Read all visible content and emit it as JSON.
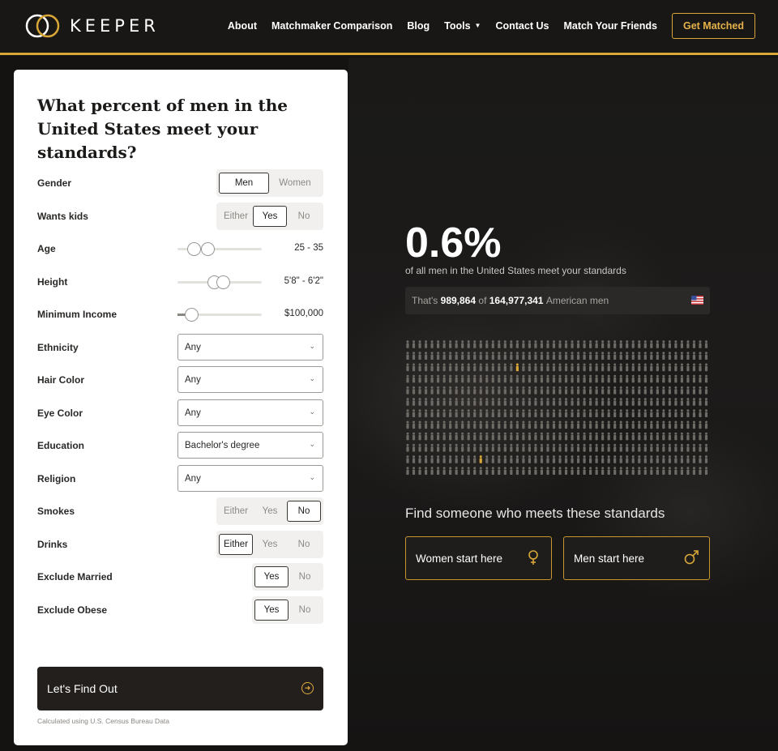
{
  "header": {
    "logo_text": "KEEPER",
    "nav": [
      {
        "label": "About"
      },
      {
        "label": "Matchmaker Comparison"
      },
      {
        "label": "Blog"
      },
      {
        "label": "Tools",
        "has_dropdown": true
      },
      {
        "label": "Contact Us"
      },
      {
        "label": "Match Your Friends"
      }
    ],
    "cta": "Get Matched",
    "accent_color": "#d9a737"
  },
  "form": {
    "title": "What percent of men in the United States meet your standards?",
    "gender": {
      "label": "Gender",
      "options": [
        "Men",
        "Women"
      ],
      "selected": "Men"
    },
    "wants_kids": {
      "label": "Wants kids",
      "options": [
        "Either",
        "Yes",
        "No"
      ],
      "selected": "Yes"
    },
    "age": {
      "label": "Age",
      "value": "25 - 35"
    },
    "height": {
      "label": "Height",
      "value": "5'8\" - 6'2\""
    },
    "income": {
      "label": "Minimum Income",
      "value": "$100,000"
    },
    "ethnicity": {
      "label": "Ethnicity",
      "value": "Any"
    },
    "hair_color": {
      "label": "Hair Color",
      "value": "Any"
    },
    "eye_color": {
      "label": "Eye Color",
      "value": "Any"
    },
    "education": {
      "label": "Education",
      "value": "Bachelor's degree"
    },
    "religion": {
      "label": "Religion",
      "value": "Any"
    },
    "smokes": {
      "label": "Smokes",
      "options": [
        "Either",
        "Yes",
        "No"
      ],
      "selected": "No"
    },
    "drinks": {
      "label": "Drinks",
      "options": [
        "Either",
        "Yes",
        "No"
      ],
      "selected": "Either"
    },
    "exclude_married": {
      "label": "Exclude Married",
      "options": [
        "Yes",
        "No"
      ],
      "selected": "Yes"
    },
    "exclude_obese": {
      "label": "Exclude Obese",
      "options": [
        "Yes",
        "No"
      ],
      "selected": "Yes"
    },
    "submit": "Let's Find Out",
    "footnote": "Calculated using U.S. Census Bureau Data"
  },
  "result": {
    "percent": "0.6%",
    "subtitle": "of all men in the United States meet your standards",
    "count_prefix": "That's",
    "count": "989,864",
    "count_of": "of",
    "total": "164,977,341",
    "count_suffix": "American men",
    "flag_icon": "us-flag-icon",
    "find_text": "Find someone who meets these standards",
    "women_button": "Women start here",
    "men_button": "Men start here",
    "people_icon": "person-icon",
    "highlight_color": "#d9a737"
  }
}
